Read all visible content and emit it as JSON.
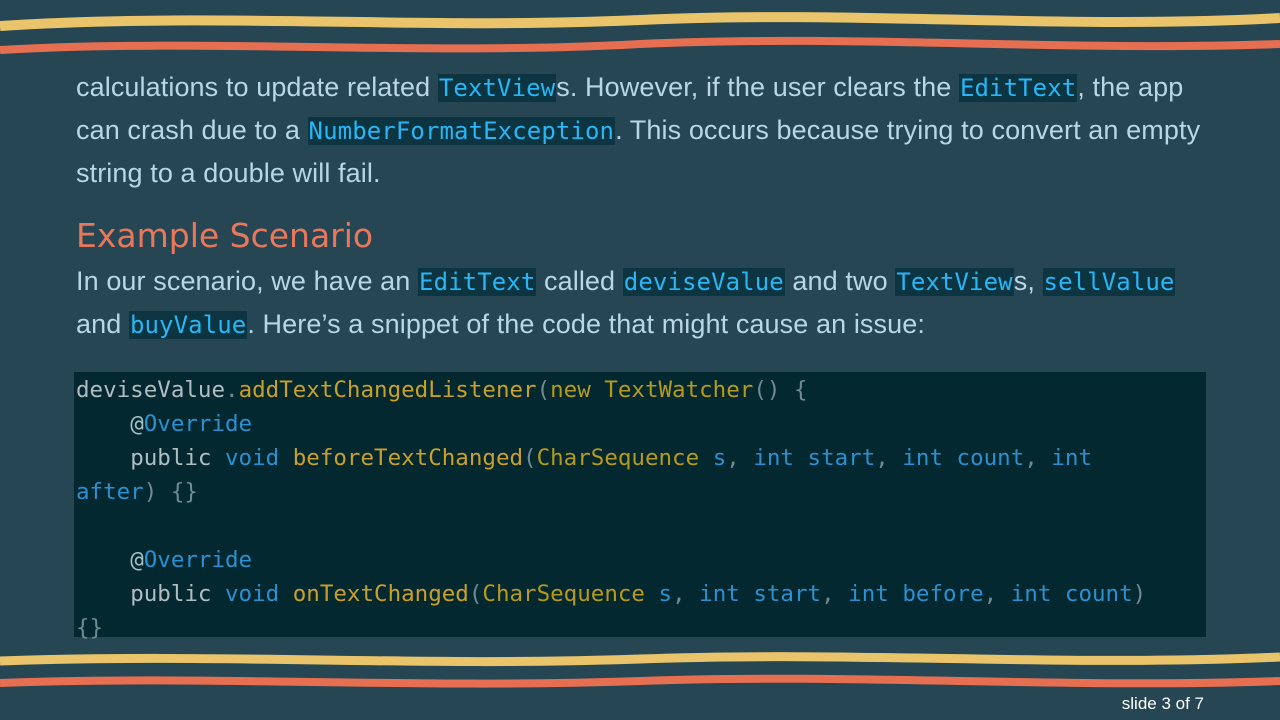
{
  "paragraph1": {
    "t1": "calculations to update related ",
    "c1": "TextView",
    "t2": "s. However, if the user clears the ",
    "c2": "EditText",
    "t3": ", the app can crash due to a ",
    "c3": "NumberFormatException",
    "t4": ". This occurs because trying to convert an empty string to a double will fail."
  },
  "heading": "Example Scenario",
  "paragraph2": {
    "t1": "In our scenario, we have an ",
    "c1": "EditText",
    "t2": " called ",
    "c2": "deviseValue",
    "t3": " and two ",
    "c3": "TextView",
    "t4": "s, ",
    "c4": "sellValue",
    "t5": " and ",
    "c5": "buyValue",
    "t6": ". Here’s a snippet of the code that might cause an issue:"
  },
  "code": {
    "l1_obj": "deviseValue",
    "l1_dot": ".",
    "l1_method": "addTextChangedListener",
    "l1_open": "(",
    "l1_new": "new",
    "l1_cls": " TextWatcher",
    "l1_rest": "() {",
    "ann_at": "@",
    "ann_name": "Override",
    "l3_public": "public",
    "l3_void": " void",
    "l3_method": " beforeTextChanged",
    "l3_open": "(",
    "l3_type": "CharSequence",
    "l3_s": " s",
    "l3_c1": ",",
    "l3_int1": " int start",
    "l3_c2": ",",
    "l3_int2": " int count",
    "l3_c3": ",",
    "l3_int3": " int",
    "l4_after": "after",
    "l4_rest": ") {}",
    "l6_public": "public",
    "l6_void": " void",
    "l6_method": " onTextChanged",
    "l6_open": "(",
    "l6_type": "CharSequence",
    "l6_s": " s",
    "l6_c1": ",",
    "l6_int1": " int start",
    "l6_c2": ",",
    "l6_int2": " int before",
    "l6_c3": ",",
    "l6_int3": " int count",
    "l6_close": ")",
    "l7_rest": "{}"
  },
  "footer": "slide 3 of 7",
  "colors": {
    "background": "#264653",
    "accent_yellow": "#e9c46a",
    "accent_orange": "#e76f51",
    "heading": "#e9785b",
    "inline_code": "#28b6f6"
  }
}
